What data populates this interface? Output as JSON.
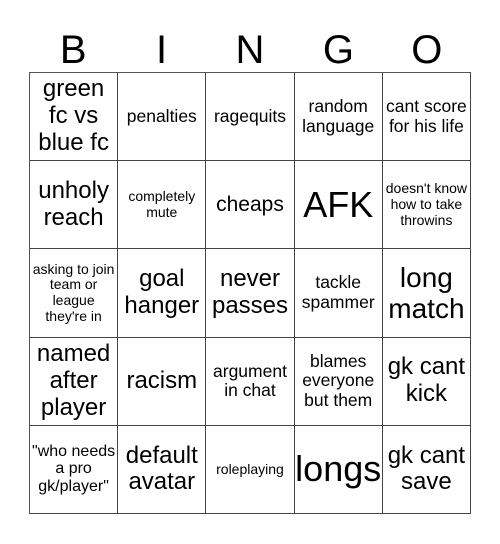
{
  "header": {
    "letters": [
      "B",
      "I",
      "N",
      "G",
      "O"
    ]
  },
  "board": {
    "rows": [
      [
        "green fc vs blue fc",
        "penalties",
        "ragequits",
        "random language",
        "cant score for his life"
      ],
      [
        "unholy reach",
        "completely mute",
        "cheaps",
        "AFK",
        "doesn't know how to take throwins"
      ],
      [
        "asking to join team or league they're in",
        "goal hanger",
        "never passes",
        "tackle spammer",
        "long match"
      ],
      [
        "named after player",
        "racism",
        "argument in chat",
        "blames everyone but them",
        "gk cant kick"
      ],
      [
        "\"who needs a pro gk/player\"",
        "default avatar",
        "roleplaying",
        "longs",
        "gk cant save"
      ]
    ]
  }
}
